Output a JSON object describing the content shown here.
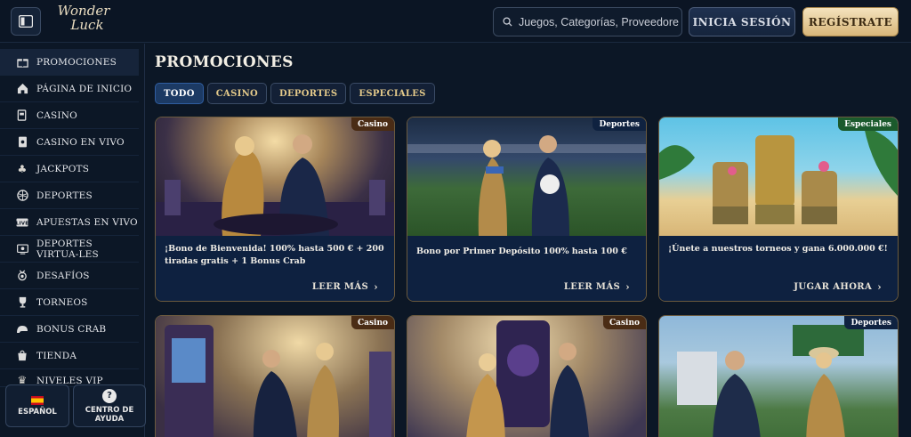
{
  "header": {
    "logo_line1": "Wonder",
    "logo_line2": "Luck",
    "search_placeholder": "Juegos, Categorías, Proveedores",
    "login_label": "INICIA SESIÓN",
    "register_label": "REGÍSTRATE"
  },
  "sidebar": {
    "items": [
      {
        "label": "PROMOCIONES",
        "icon": "gift-icon"
      },
      {
        "label": "PÁGINA DE INICIO",
        "icon": "home-icon"
      },
      {
        "label": "CASINO",
        "icon": "slot-machine-icon"
      },
      {
        "label": "CASINO EN VIVO",
        "icon": "live-card-icon"
      },
      {
        "label": "JACKPOTS",
        "icon": "clover-icon"
      },
      {
        "label": "DEPORTES",
        "icon": "ball-icon"
      },
      {
        "label": "APUESTAS EN VIVO",
        "icon": "live-icon"
      },
      {
        "label": "DEPORTES VIRTUA-LES",
        "icon": "virtual-sports-icon"
      },
      {
        "label": "DESAFÍOS",
        "icon": "medal-icon"
      },
      {
        "label": "TORNEOS",
        "icon": "trophy-icon"
      },
      {
        "label": "BONUS CRAB",
        "icon": "crab-icon"
      },
      {
        "label": "TIENDA",
        "icon": "shop-icon"
      },
      {
        "label": "NIVELES VIP",
        "icon": "vip-icon"
      }
    ],
    "language_label": "ESPAÑOL",
    "help_label": "CENTRO DE AYUDA"
  },
  "main": {
    "title": "PROMOCIONES",
    "filters": [
      "TODO",
      "CASINO",
      "DEPORTES",
      "ESPECIALES"
    ],
    "active_filter": "TODO",
    "cards": [
      {
        "badge": "Casino",
        "description": "¡Bono de Bienvenida! 100% hasta 500 € + 200 tiradas gratis + 1 Bonus Crab",
        "action": "LEER MÁS"
      },
      {
        "badge": "Deportes",
        "description": "Bono por Primer Depósito 100% hasta 100 €",
        "action": "LEER MÁS"
      },
      {
        "badge": "Especiales",
        "description": "¡Únete a nuestros torneos y gana 6.000.000 €!",
        "action": "JUGAR AHORA"
      },
      {
        "badge": "Casino",
        "description": "",
        "action": ""
      },
      {
        "badge": "Casino",
        "description": "",
        "action": ""
      },
      {
        "badge": "Deportes",
        "description": "",
        "action": ""
      }
    ]
  },
  "colors": {
    "background": "#0c1726",
    "accent_gold": "#e3c98a",
    "active_filter": "#1c3a64",
    "badge_casino": "#4a2c15",
    "badge_deportes": "#0f2240",
    "badge_especiales": "#1b5a2c"
  }
}
